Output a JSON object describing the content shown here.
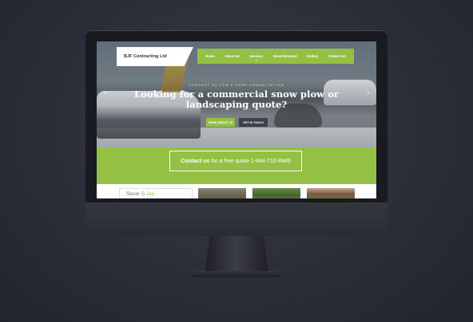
{
  "site": {
    "brand": "BJF Contracting Ltd",
    "nav": [
      {
        "label": "Home"
      },
      {
        "label": "About Us"
      },
      {
        "label": "Services"
      },
      {
        "label": "Snow Removal"
      },
      {
        "label": "Gallery"
      },
      {
        "label": "Contact Us"
      }
    ],
    "hero": {
      "eyebrow": "CONTACT US FOR A FREE CONSULTATION",
      "headline": "Looking for a commercial snow plow or landscaping quote?",
      "primary_button": "MORE ABOUT US",
      "secondary_button": "GET IN TOUCH",
      "prev_arrow": "‹",
      "next_arrow": "›"
    },
    "cta": {
      "bold_text": "Contact us",
      "text": "for a free quote",
      "phone": "1-844-710-8949"
    },
    "cards": {
      "teaser_left": "Snow",
      "teaser_right": "& lan"
    }
  },
  "colors": {
    "accent_green": "#94c044",
    "dark_button": "#3d4147",
    "background": "#2b2d38"
  },
  "icons": {
    "device_logo": "apple-icon",
    "slider_prev": "chevron-left-icon",
    "slider_next": "chevron-right-icon"
  }
}
